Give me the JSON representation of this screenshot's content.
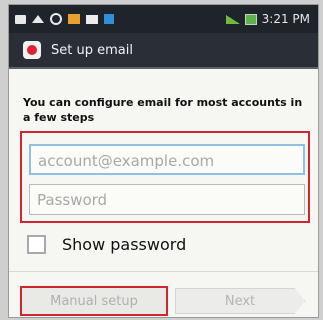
{
  "status_bar": {
    "time": "3:21 PM",
    "icons": [
      "notification-icon",
      "home-icon",
      "sync-icon",
      "photo-icon",
      "mail-icon",
      "app-icon",
      "signal-icon",
      "battery-icon"
    ]
  },
  "header": {
    "title": "Set up email",
    "icon": "email-app-icon"
  },
  "intro_text": "You can configure email for most accounts in a few steps",
  "email_field": {
    "placeholder": "account@example.com"
  },
  "password_field": {
    "placeholder": "Password"
  },
  "show_password": {
    "label": "Show password",
    "checked": false
  },
  "buttons": {
    "manual_setup": "Manual setup",
    "next": "Next"
  },
  "colors": {
    "highlight": "#d2262f",
    "focus": "#8ec1e0",
    "titlebar": "#2a2f37"
  }
}
